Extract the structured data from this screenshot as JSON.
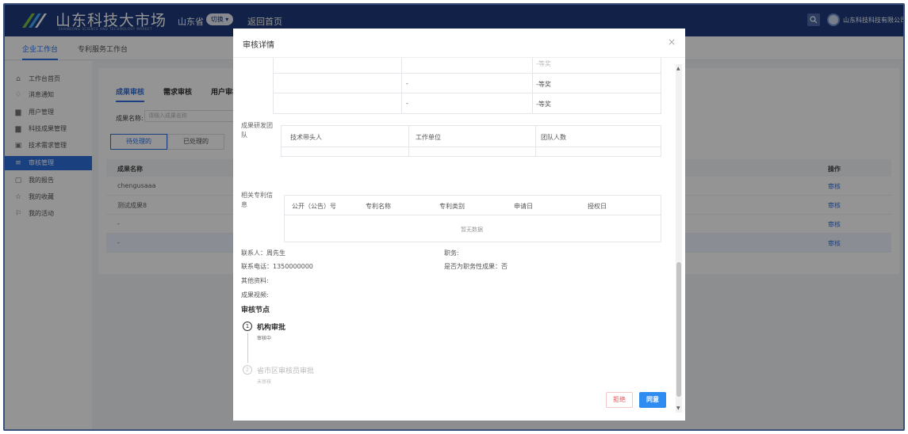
{
  "header": {
    "title": "山东科技大市场",
    "subtitle": "SHANDONG SCIENCE AND TECHNOLOGY MARKET",
    "province": "山东省",
    "switch_label": "切换",
    "home_link": "返回首页",
    "company": "山东科技科技有限公司"
  },
  "topnav": {
    "tabs": [
      "企业工作台",
      "专利服务工作台"
    ]
  },
  "sidebar": {
    "items": [
      {
        "label": "工作台首页",
        "icon": "home-icon"
      },
      {
        "label": "消息通知",
        "icon": "bell-icon"
      },
      {
        "label": "用户管理",
        "icon": "users-icon"
      },
      {
        "label": "科技成果管理",
        "icon": "folder-icon"
      },
      {
        "label": "技术需求管理",
        "icon": "doc-icon"
      },
      {
        "label": "审核管理",
        "icon": "audit-icon"
      },
      {
        "label": "我的报告",
        "icon": "report-icon"
      },
      {
        "label": "我的收藏",
        "icon": "star-icon"
      },
      {
        "label": "我的活动",
        "icon": "flag-icon"
      }
    ]
  },
  "main": {
    "sub_tabs": [
      "成果审核",
      "需求审核",
      "用户审核"
    ],
    "filter_label": "成果名称:",
    "filter_placeholder": "请输入成果名称",
    "status_tabs": [
      "待处理的",
      "已处理的"
    ],
    "table": {
      "col_name": "成果名称",
      "col_action": "操作",
      "rows": [
        {
          "name": "chengusaaa",
          "action": "审核"
        },
        {
          "name": "测试成果8",
          "action": "审核"
        },
        {
          "name": "-",
          "action": "审核"
        },
        {
          "name": "-",
          "action": "审核"
        }
      ]
    }
  },
  "modal": {
    "title": "审核详情",
    "close": "×",
    "award_rows": [
      {
        "a": "-",
        "b": "-等奖"
      },
      {
        "a": "-",
        "b": "-等奖"
      },
      {
        "a": "-",
        "b": "-等奖"
      }
    ],
    "team": {
      "label": "成果研发团队",
      "headers": [
        "技术带头人",
        "工作单位",
        "团队人数"
      ]
    },
    "patent": {
      "label": "相关专利信息",
      "headers": [
        "公开（公告）号",
        "专利名称",
        "专利类别",
        "申请日",
        "授权日"
      ],
      "empty": "暂无数据"
    },
    "info": {
      "contact": "联系人：周先生",
      "phone": "联系电话：1350000000",
      "other": "其他资料:",
      "video": "成果视频:",
      "position": "职务:",
      "is_duty": "是否为职务性成果：否"
    },
    "nodes_title": "审核节点",
    "steps": [
      {
        "num": "1",
        "name": "机构审批",
        "status": "审核中"
      },
      {
        "num": "2",
        "name": "省市区审核员审批",
        "status": "未审核"
      }
    ],
    "reject": "拒绝",
    "agree": "同意"
  }
}
